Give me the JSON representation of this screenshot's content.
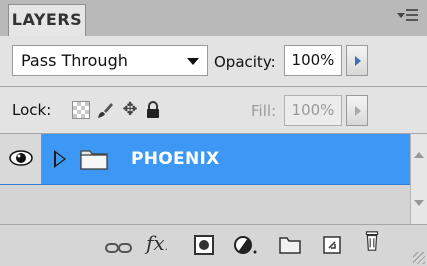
{
  "panel": {
    "tab_label": "LAYERS"
  },
  "blend": {
    "value": "Pass Through"
  },
  "opacity": {
    "label": "Opacity:",
    "value": "100%"
  },
  "lock": {
    "label": "Lock:"
  },
  "fill": {
    "label": "Fill:",
    "value": "100%"
  },
  "layers": [
    {
      "name": "PHOENIX",
      "type": "group",
      "visible": true,
      "selected": true
    }
  ],
  "toolbar": {
    "icons": [
      "link-layers-icon",
      "fx-icon",
      "layer-mask-icon",
      "adjustment-layer-icon",
      "new-group-icon",
      "new-layer-icon",
      "trash-icon"
    ],
    "fx_label": "fx"
  },
  "colors": {
    "selection": "#3d98f5",
    "panel_bg": "#e3e3e3",
    "accent_arrow": "#3b6fb0"
  }
}
